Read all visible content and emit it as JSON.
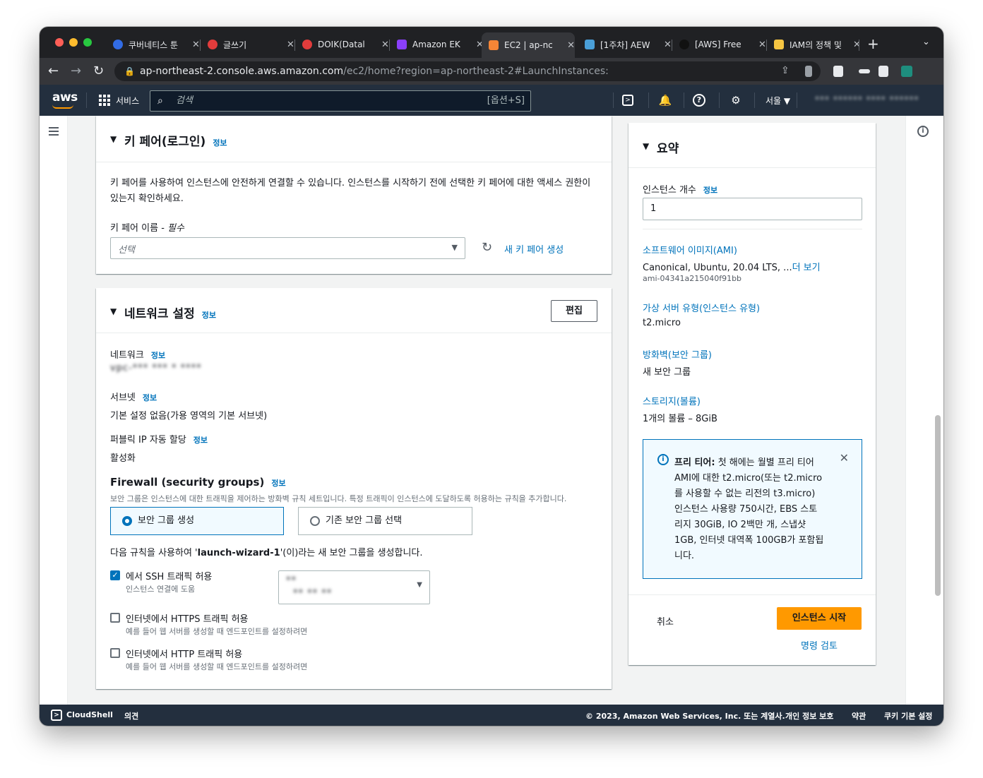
{
  "tabs": [
    {
      "title": "쿠버네티스 툰",
      "color": "#326ce5"
    },
    {
      "title": "글쓰기",
      "color": "#e23c3c"
    },
    {
      "title": "DOIK(Datal",
      "color": "#e23c3c"
    },
    {
      "title": "Amazon EK",
      "color": "#8a3ffc"
    },
    {
      "title": "EC2 | ap-nc",
      "color": "#f58536"
    },
    {
      "title": "[1주차] AEW",
      "color": "#4a9fd8"
    },
    {
      "title": "[AWS] Free",
      "color": "#111111"
    },
    {
      "title": "IAM의 정책 및",
      "color": "#f5c542"
    }
  ],
  "browser": {
    "url_host": "ap-northeast-2.console.aws.amazon.com",
    "url_rest": "/ec2/home?region=ap-northeast-2#LaunchInstances:"
  },
  "aws": {
    "logo": "aws",
    "services": "서비스",
    "search_placeholder": "검색",
    "search_shortcut": "[옵션+S]",
    "region": "서울 ▼",
    "account": "*** ****** **** ******"
  },
  "keypair": {
    "title": "키 페어(로그인)",
    "info": "정보",
    "description_1": "키 페어를 사용하여 인스턴스에 안전하게 연결할 수 있습니다. 인스턴스를 시작하기 전에 선택한 키 페어에 대한 액세스 권한이",
    "description_2": "있는지 확인하세요.",
    "name_label": "키 페어 이름 - ",
    "name_required": "필수",
    "select_placeholder": "선택",
    "create_new": "새 키 페어 생성"
  },
  "network": {
    "title": "네트워크 설정",
    "info": "정보",
    "edit": "편집",
    "network_label": "네트워크",
    "network_value": "vpc-*** *** * ****",
    "subnet_label": "서브넷",
    "subnet_value": "기본 설정 없음(가용 영역의 기본 서브넷)",
    "public_ip_label": "퍼블릭 IP 자동 할당",
    "public_ip_value": "활성화",
    "firewall_title": "Firewall (security groups)",
    "firewall_desc": "보안 그룹은 인스턴스에 대한 트래픽을 제어하는 방화벽 규칙 세트입니다. 특정 트래픽이 인스턴스에 도달하도록 허용하는 규칙을 추가합니다.",
    "option_create": "보안 그룹 생성",
    "option_existing": "기존 보안 그룹 선택",
    "rule_prefix": "다음 규칙을 사용하여 '",
    "rule_name": "launch-wizard-1",
    "rule_suffix": "'(이)라는 새 보안 그룹을 생성합니다.",
    "ssh_label": "에서 SSH 트래픽 허용",
    "ssh_sub": "인스턴스 연결에 도움",
    "ssh_source_1": "**",
    "ssh_source_2": "** ** **",
    "https_label": "인터넷에서 HTTPS 트래픽 허용",
    "https_sub": "예를 들어 웹 서버를 생성할 때 엔드포인트를 설정하려면",
    "http_label": "인터넷에서 HTTP 트래픽 허용",
    "http_sub": "예를 들어 웹 서버를 생성할 때 엔드포인트를 설정하려면"
  },
  "summary": {
    "title": "요약",
    "count_label": "인스턴스 개수",
    "info": "정보",
    "count_value": "1",
    "ami_label": "소프트웨어 이미지(AMI)",
    "ami_value": "Canonical, Ubuntu, 20.04 LTS, ...",
    "ami_more": "더 보기",
    "ami_id": "ami-04341a215040f91bb",
    "type_label": "가상 서버 유형(인스턴스 유형)",
    "type_value": "t2.micro",
    "firewall_label": "방화벽(보안 그룹)",
    "firewall_value": "새 보안 그룹",
    "storage_label": "스토리지(볼륨)",
    "storage_value": "1개의 볼륨 – 8GiB",
    "free_tier_bold": "프리 티어:",
    "free_tier_lines": [
      " 첫 해에는 월별 프리 티어",
      "AMI에 대한 t2.micro(또는 t2.micro",
      "를 사용할 수 없는 리전의 t3.micro)",
      "인스턴스 사용량 750시간, EBS 스토",
      "리지 30GiB, IO 2백만 개, 스냅샷",
      "1GB, 인터넷 대역폭 100GB가 포함됩",
      "니다."
    ],
    "cancel": "취소",
    "launch": "인스턴스 시작",
    "review": "명령 검토"
  },
  "footer": {
    "cloudshell": "CloudShell",
    "feedback": "의견",
    "copyright": "© 2023, Amazon Web Services, Inc. 또는 계열사.",
    "privacy": "개인 정보 보호",
    "terms": "약관",
    "cookies": "쿠키 기본 설정"
  }
}
